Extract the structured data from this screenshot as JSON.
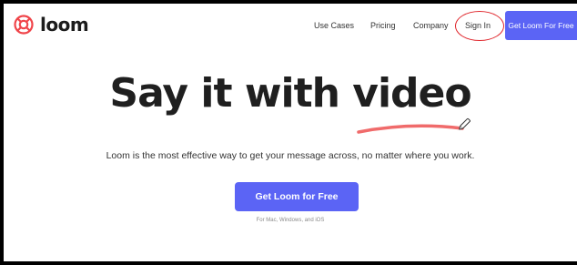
{
  "brand": {
    "name": "loom",
    "logo_icon": "loom-logo-icon",
    "color": "#f0454a"
  },
  "nav": {
    "links": [
      "Use Cases",
      "Pricing",
      "Company"
    ],
    "sign_in": "Sign In",
    "cta": "Get Loom For Free"
  },
  "hero": {
    "headline": "Say it with video",
    "subtitle": "Loom is the most effective way to get your message across, no matter where you work.",
    "cta": "Get Loom for Free",
    "platforms": "For Mac, Windows, and iOS"
  },
  "colors": {
    "accent": "#5b64f5",
    "highlight_stroke": "#e0282e",
    "underline": "#f06b6b"
  }
}
